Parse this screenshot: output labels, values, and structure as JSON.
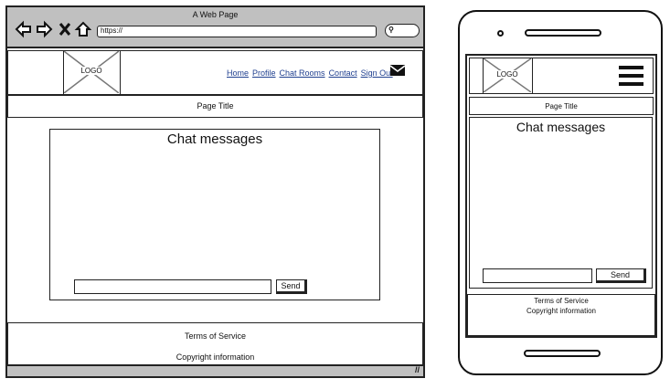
{
  "desktop": {
    "window_title": "A Web Page",
    "url": "https://",
    "logo": "LOGO",
    "nav": [
      "Home",
      "Profile",
      "Chat Rooms",
      "Contact",
      "Sign Out"
    ],
    "page_title": "Page Title",
    "chat_title": "Chat messages",
    "send_label": "Send",
    "footer": {
      "terms": "Terms of Service",
      "copyright": "Copyright information"
    }
  },
  "mobile": {
    "logo": "LOGO",
    "page_title": "Page Title",
    "chat_title": "Chat messages",
    "send_label": "Send",
    "footer": {
      "terms": "Terms of Service",
      "copyright": "Copyright information"
    }
  },
  "colors": {
    "frame_gray": "#c0c0c0",
    "link": "#1f3f8f"
  }
}
